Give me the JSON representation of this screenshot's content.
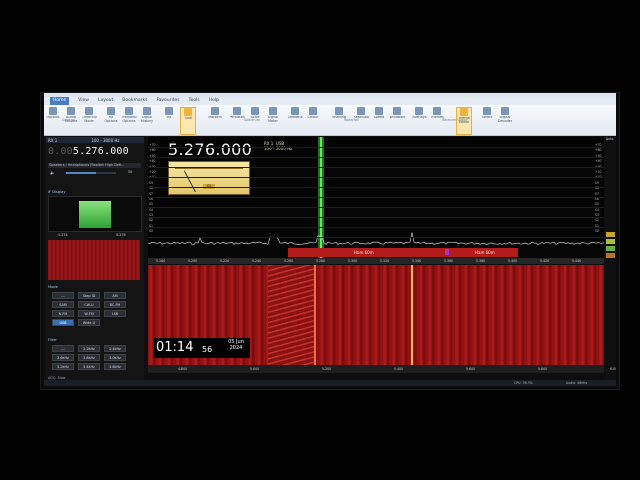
{
  "ribbon": {
    "tabs": [
      {
        "label": "Home",
        "active": true
      },
      {
        "label": "View",
        "active": false
      },
      {
        "label": "Layout",
        "active": false
      },
      {
        "label": "Bookmarks",
        "active": false
      },
      {
        "label": "Favourites",
        "active": false
      },
      {
        "label": "Tools",
        "active": false
      },
      {
        "label": "Help",
        "active": false
      }
    ],
    "buttons": [
      "Options",
      "Audio Volume",
      "Continuous Mode",
      "RX Options",
      "Frequency Options",
      "Signal History",
      "RX",
      "Tune",
      "Markers",
      "Persistence",
      "Scale",
      "Signal Meter",
      "Smoothing",
      "Colour",
      "Shading",
      "Resolution",
      "Speed",
      "Windowing",
      "Overlays",
      "Themes",
      "Theme Editor",
      "Select",
      "Digital Decoder"
    ],
    "highlighted": [
      "Tune",
      "Theme Editor"
    ],
    "toggles": [
      "Mute Indicator",
      "Quick Bookmarks",
      "Audio settings",
      "Mouse wheel buttons",
      "Peak Hold",
      "FFT Stats",
      "Main",
      "Frequency"
    ]
  },
  "left": {
    "rx_label": "RX 1",
    "bandwidth": "100 - 3000 Hz",
    "freq_dim": "0.00",
    "freq_main": "5.276.000",
    "audio_device": "Speakers / Headphones (Realtek High Defi...",
    "volume_max": "50",
    "volume_level": 0.6,
    "if_display_label": "IF Display",
    "if_scale": [
      "5.274",
      "5.276"
    ],
    "mode_label": "Mode",
    "modes": [
      {
        "label": "---",
        "selected": false
      },
      {
        "label": "Step ID",
        "selected": false
      },
      {
        "label": "AM",
        "selected": false
      },
      {
        "label": "SAM",
        "selected": false
      },
      {
        "label": "CW-U",
        "selected": false
      },
      {
        "label": "BC-FM",
        "selected": false
      },
      {
        "label": "N-FM",
        "selected": false
      },
      {
        "label": "W-FM",
        "selected": false
      },
      {
        "label": "LSB",
        "selected": false
      },
      {
        "label": "USB",
        "selected": true
      },
      {
        "label": "Wide-U",
        "selected": false
      }
    ],
    "filter_label": "Filter",
    "filters": [
      "---",
      "2.2kHz",
      "2.4kHz",
      "2.6kHz",
      "2.8kHz",
      "3.0kHz",
      "3.2kHz",
      "3.4kHz",
      "3.6kHz"
    ],
    "agc": "AGC: Slow"
  },
  "spectrum": {
    "big_freq": "5.276.000",
    "rx_label": "RX 1",
    "mode": "USB",
    "bandwidth": "100 - 3000 Hz",
    "smeter_value": "S5",
    "db_scale": [
      "+70",
      "+60",
      "+50",
      "+40",
      "+30",
      "+20",
      "+10",
      "S9",
      "S8",
      "S7",
      "S6",
      "S5",
      "S4",
      "S3",
      "S2",
      "S1",
      "S0"
    ],
    "bands": [
      {
        "label": "Ham 60m"
      },
      {
        "label": "Ham 60m"
      }
    ],
    "axis_ticks": [
      "5.160",
      "5.200",
      "5.220",
      "5.240",
      "5.260",
      "5.280",
      "5.300",
      "5.320",
      "5.340",
      "5.360",
      "5.380",
      "5.400",
      "5.420",
      "5.440"
    ]
  },
  "right": {
    "auto_label": "Auto"
  },
  "waterfall": {
    "time_hm": "01:14",
    "time_s": "56",
    "date_day": "05 Jun",
    "date_year": "2024",
    "axis_ticks": [
      "4.800",
      "5.000",
      "5.200",
      "5.400",
      "5.600",
      "5.800",
      "6.000"
    ]
  },
  "status": {
    "cpu": "CPU: 36.3%",
    "audio": "Audio: 48kHz"
  },
  "colors": {
    "accent": "#4a7cc2",
    "tune_line": "#5ef05a",
    "band_bar": "#b41c1c",
    "waterfall": "#a51a1c"
  }
}
